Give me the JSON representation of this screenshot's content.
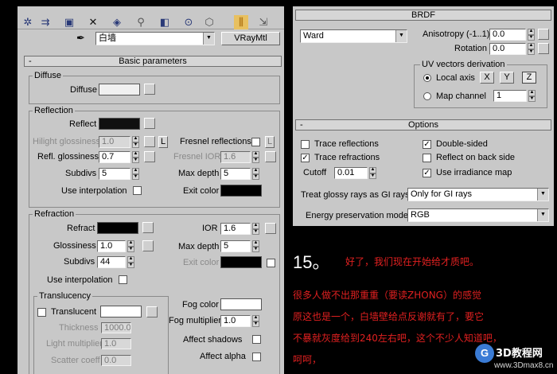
{
  "material": {
    "name": "白墙",
    "type_button": "VRayMtl"
  },
  "basic": {
    "rollout_title": "Basic parameters",
    "collapse_glyph": "-",
    "diffuse_group": "Diffuse",
    "diffuse_label": "Diffuse",
    "reflection_group": "Reflection",
    "reflect_label": "Reflect",
    "hilight_label": "Hilight glossiness",
    "hilight_value": "1.0",
    "lock_glyph": "L",
    "fresnel_label": "Fresnel reflections",
    "refl_gloss_label": "Refl. glossiness",
    "refl_gloss_value": "0.7",
    "fresnel_ior_label": "Fresnel IOR",
    "fresnel_ior_value": "1.6",
    "subdivs_label": "Subdivs",
    "refl_subdivs_value": "5",
    "max_depth_label": "Max depth",
    "refl_max_depth_value": "5",
    "use_interp_label": "Use interpolation",
    "exit_color_label": "Exit color",
    "refraction_group": "Refraction",
    "refract_label": "Refract",
    "ior_label": "IOR",
    "ior_value": "1.6",
    "glossiness_label": "Glossiness",
    "glossiness_value": "1.0",
    "refr_max_depth_value": "5",
    "refr_subdivs_value": "44",
    "translucency_group": "Translucency",
    "translucent_label": "Translucent",
    "fog_color_label": "Fog color",
    "thickness_label": "Thickness",
    "thickness_value": "1000.0",
    "fog_mult_label": "Fog multiplier",
    "fog_mult_value": "1.0",
    "light_mult_label": "Light multiplier",
    "light_mult_value": "1.0",
    "affect_shadows_label": "Affect shadows",
    "scatter_label": "Scatter coeff",
    "scatter_value": "0.0",
    "affect_alpha_label": "Affect alpha"
  },
  "brdf": {
    "title": "BRDF",
    "type": "Ward",
    "anisotropy_label": "Anisotropy (-1..1)",
    "anisotropy_value": "0.0",
    "rotation_label": "Rotation",
    "rotation_value": "0.0",
    "uv_group": "UV vectors derivation",
    "local_axis_label": "Local axis",
    "axis_x": "X",
    "axis_y": "Y",
    "axis_z": "Z",
    "map_channel_label": "Map channel",
    "map_channel_value": "1"
  },
  "options": {
    "title": "Options",
    "trace_reflections": "Trace reflections",
    "double_sided": "Double-sided",
    "trace_refractions": "Trace refractions",
    "reflect_back": "Reflect on back side",
    "cutoff_label": "Cutoff",
    "cutoff_value": "0.01",
    "use_irradiance": "Use irradiance map",
    "glossy_label": "Treat glossy rays as GI rays:",
    "glossy_value": "Only for GI rays",
    "energy_label": "Energy preservation mode:",
    "energy_value": "RGB",
    "check_glyph": "✓"
  },
  "tutorial": {
    "step": "15。",
    "line1": "好了，我们现在开始给才质吧。",
    "line2": "很多人做不出那重重（要读ZHONG）的感觉",
    "line3": "原这也是一个，白墙壁给点反谢就有了，要它",
    "line4": "不暴就灰度给到240左右吧，这个不少人知道吧，",
    "line5": "呵呵，"
  },
  "watermark": {
    "logo_text": "3D教程网",
    "url": "www.3Dmax8.cn"
  },
  "colors": {
    "panel_bg": "#c8c8c8",
    "text_red": "#e02020",
    "diffuse_swatch": "#f0f0f0",
    "reflect_swatch": "#101010"
  }
}
